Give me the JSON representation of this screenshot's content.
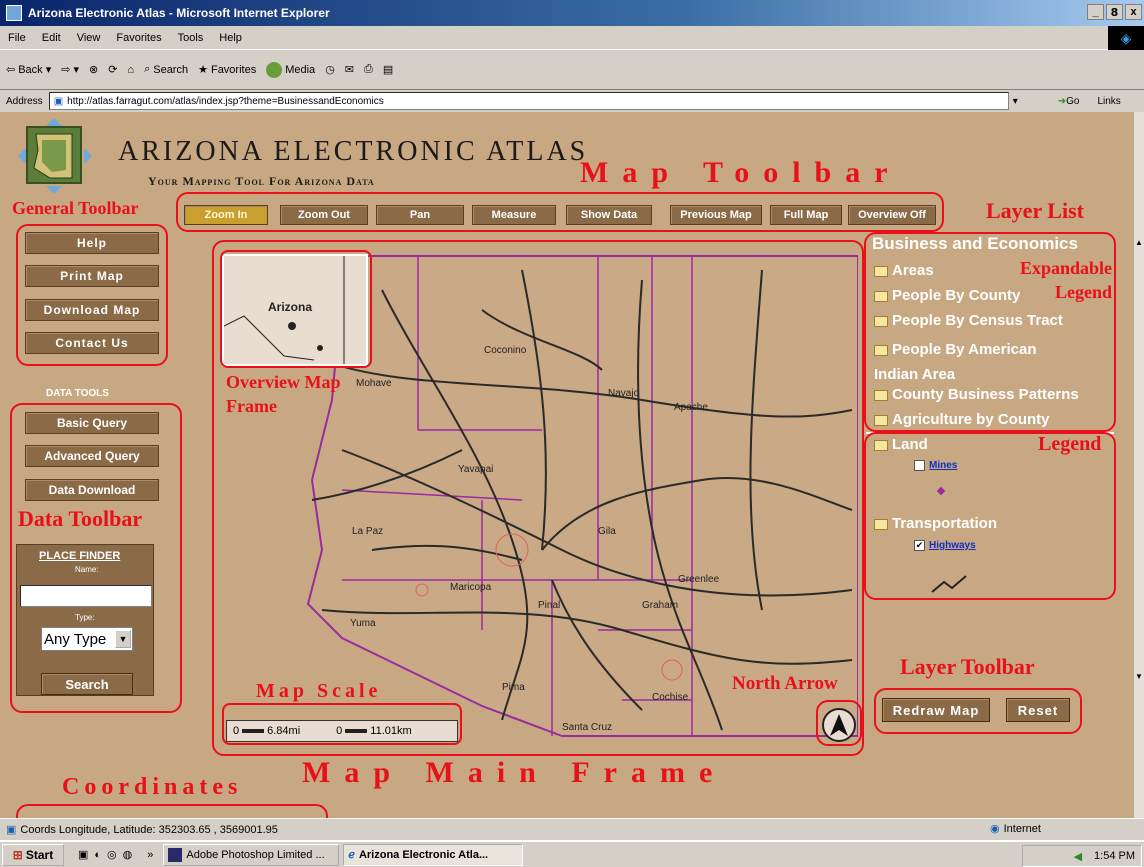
{
  "window": {
    "title": "Arizona Electronic Atlas - Microsoft Internet Explorer",
    "controls": [
      "_",
      "8",
      "x"
    ]
  },
  "menu": [
    "File",
    "Edit",
    "View",
    "Favorites",
    "Tools",
    "Help"
  ],
  "browser_toolbar": {
    "back": "Back",
    "search": "Search",
    "favorites": "Favorites",
    "media": "Media"
  },
  "address": {
    "label": "Address",
    "url": "http://atlas.farragut.com/atlas/index.jsp?theme=BusinessandEconomics",
    "go": "Go",
    "links": "Links"
  },
  "site": {
    "title": "Arizona Electronic Atlas",
    "subtitle": "Your Mapping Tool For Arizona Data"
  },
  "map_toolbar": [
    "Zoom In",
    "Zoom Out",
    "Pan",
    "Measure",
    "Show Data",
    "Previous Map",
    "Full Map",
    "Overview Off"
  ],
  "general_toolbar": [
    "Help",
    "Print Map",
    "Download Map",
    "Contact Us"
  ],
  "data_tools": {
    "heading": "DATA TOOLS",
    "buttons": [
      "Basic Query",
      "Advanced Query",
      "Data Download"
    ]
  },
  "place_finder": {
    "title": "PLACE FINDER",
    "name_label": "Name:",
    "type_label": "Type:",
    "type_value": "Any Type",
    "search": "Search"
  },
  "map": {
    "overview_label": "Arizona",
    "places": [
      "Coconino",
      "Navajo",
      "Apache",
      "Mohave",
      "Yavapai",
      "La Paz",
      "Maricopa",
      "Gila",
      "Greenlee",
      "Pinal",
      "Graham",
      "Yuma",
      "Pima",
      "Cochise",
      "Santa Cruz"
    ],
    "scale": {
      "mi_zero": "0",
      "mi": "6.84mi",
      "km_zero": "0",
      "km": "11.01km"
    }
  },
  "layer_list": {
    "theme": "Business and Economics",
    "expandable": [
      "Areas",
      "People By County",
      "People By Census Tract",
      "People By American Indian Area",
      "County Business Patterns",
      "Agriculture by County"
    ],
    "legend": {
      "land": "Land",
      "mines": "Mines",
      "transportation": "Transportation",
      "highways": "Highways"
    }
  },
  "layer_toolbar": [
    "Redraw Map",
    "Reset"
  ],
  "annotations": {
    "map_toolbar": "Map Toolbar",
    "general_toolbar": "General Toolbar",
    "layer_list": "Layer List",
    "expandable_legend": "Expandable Legend",
    "legend": "Legend",
    "overview_map_frame": "Overview Map Frame",
    "data_toolbar": "Data Toolbar",
    "map_scale": "Map Scale",
    "north_arrow": "North Arrow",
    "layer_toolbar": "Layer Toolbar",
    "map_main_frame": "Map Main Frame",
    "coordinates": "Coordinates"
  },
  "status": {
    "coords": "Coords Longitude, Latitude: 352303.65 , 3569001.95",
    "zone": "Internet"
  },
  "taskbar": {
    "start": "Start",
    "tasks": [
      "Adobe Photoshop Limited ...",
      "Arizona Electronic Atla..."
    ],
    "time": "1:54 PM"
  },
  "colors": {
    "page_bg": "#c8a882",
    "button_bg": "#8b6a48",
    "annotation_red": "#e8101a",
    "county_border": "#9a2aa0",
    "road": "#2a2a2a"
  }
}
